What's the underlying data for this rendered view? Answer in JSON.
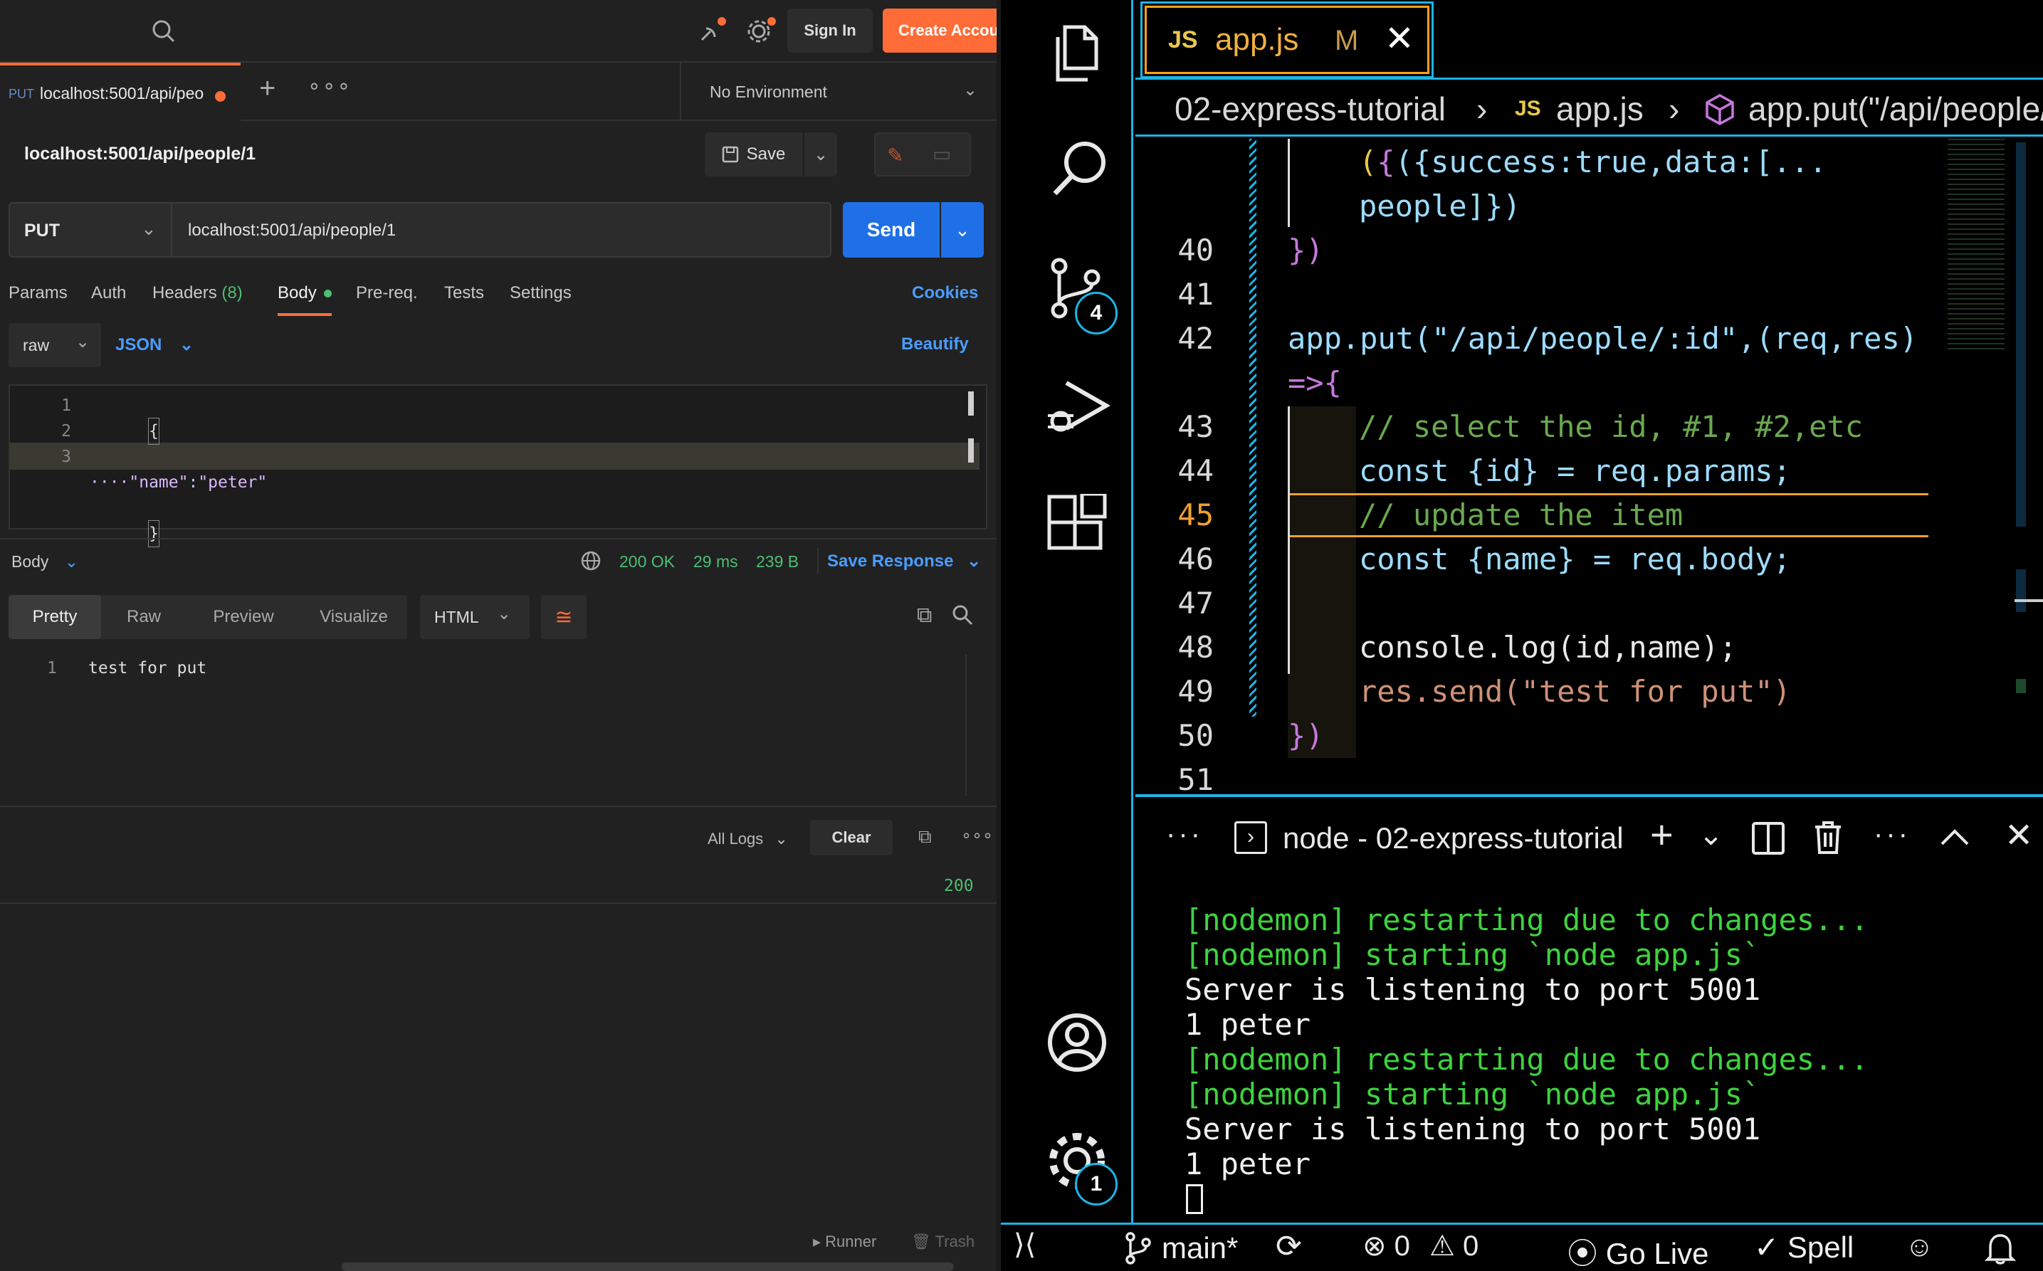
{
  "postman": {
    "header": {
      "sign_in": "Sign In",
      "create_account": "Create Accou"
    },
    "tab": {
      "method": "PUT",
      "title": "localhost:5001/api/peo"
    },
    "environment": "No Environment",
    "request_name": "localhost:5001/api/people/1",
    "save_label": "Save",
    "method": "PUT",
    "url": "localhost:5001/api/people/1",
    "send_label": "Send",
    "request_tabs": [
      "Params",
      "Auth",
      "Headers",
      "(8)",
      "Body",
      "Pre-req.",
      "Tests",
      "Settings"
    ],
    "cookies": "Cookies",
    "body_mode": "raw",
    "body_format": "JSON",
    "beautify": "Beautify",
    "body_lines": [
      "{",
      "····\"name\":\"peter\"",
      "}"
    ],
    "body_line_numbers": [
      "1",
      "2",
      "3"
    ],
    "response": {
      "section_label": "Body",
      "status": "200 OK",
      "time": "29 ms",
      "size": "239 B",
      "save_response": "Save Response",
      "view_tabs": [
        "Pretty",
        "Raw",
        "Preview",
        "Visualize"
      ],
      "format": "HTML",
      "line_number": "1",
      "body_text": "test for put"
    },
    "console": {
      "all_logs": "All Logs",
      "clear": "Clear",
      "status_code": "200"
    },
    "footer": {
      "runner": "Runner",
      "trash": "Trash"
    },
    "colors": {
      "accent_orange": "#ff6c37",
      "send_blue": "#1f6fe6",
      "link_blue": "#4a9dff",
      "status_green": "#4bbf73"
    }
  },
  "vscode": {
    "tab": {
      "icon_text": "JS",
      "filename": "app.js",
      "modified": "M"
    },
    "breadcrumb": {
      "folder": "02-express-tutorial",
      "icon_text": "JS",
      "file": "app.js",
      "symbol": "app.put(\"/api/people/"
    },
    "source_control_badge": "4",
    "settings_badge": "1",
    "line_numbers": [
      "40",
      "41",
      "42",
      "43",
      "44",
      "45",
      "46",
      "47",
      "48",
      "49",
      "50",
      "51"
    ],
    "code": {
      "l38": "({success:true,data:[...",
      "l39": "people]})",
      "l40": "})",
      "l42a": "app.put(\"/api/people/:id\",(req,res)",
      "l42b": "=>{",
      "l43": "// select the id, #1, #2,etc",
      "l44": "const {id} = req.params;",
      "l45": "// update the item",
      "l46": "const {name} = req.body;",
      "l48": "console.log(id,name);",
      "l49": "res.send(\"test for put\")",
      "l50": "})"
    },
    "terminal": {
      "title": "node - 02-express-tutorial",
      "lines": [
        "[nodemon] restarting due to changes...",
        "[nodemon] starting `node app.js`",
        "Server is listening to port 5001",
        "1 peter",
        "[nodemon] restarting due to changes...",
        "[nodemon] starting `node app.js`",
        "Server is listening to port 5001",
        "1 peter"
      ]
    },
    "status_bar": {
      "branch": "main*",
      "errors": "0",
      "warnings": "0",
      "go_live": "Go Live",
      "spell": "Spell"
    },
    "colors": {
      "accent_orange": "#f0a030",
      "tab_border": "#ff9f1a",
      "cyan_border": "#1bb4e6",
      "nodemon_green": "#3ed23e"
    }
  }
}
